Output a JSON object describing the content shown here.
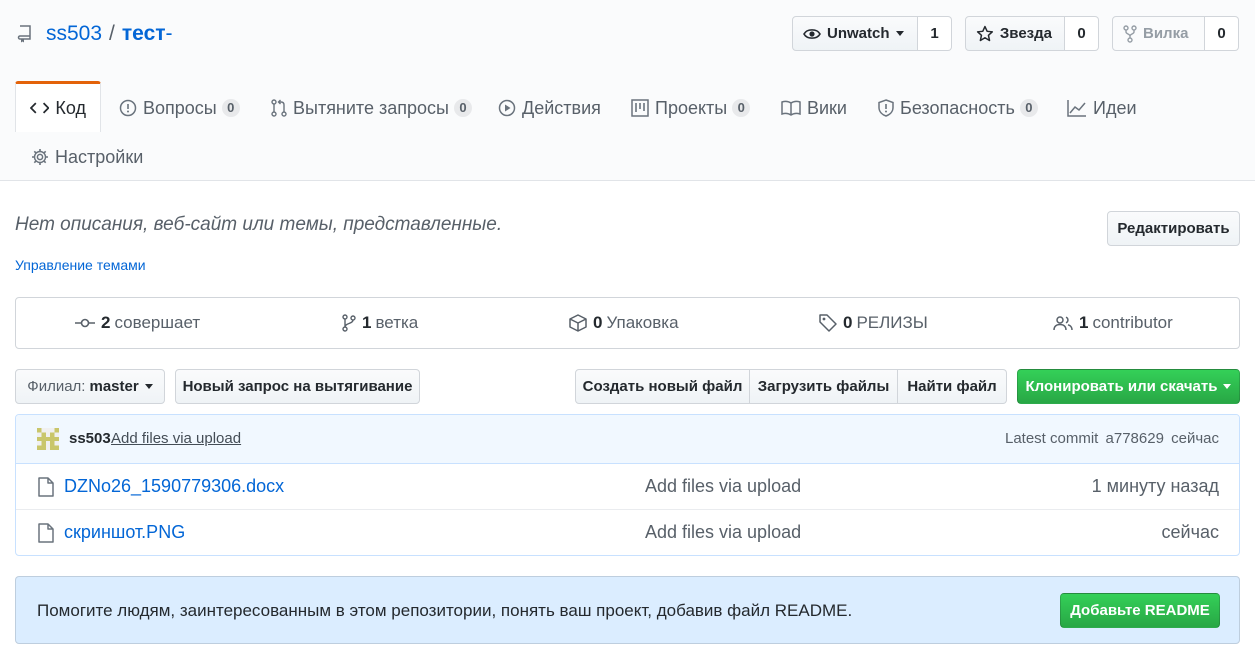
{
  "repo": {
    "owner": "ss503",
    "separator": "/",
    "name": "тест",
    "suffix": "-"
  },
  "social": {
    "watch": {
      "label": "Unwatch",
      "count": "1"
    },
    "star": {
      "label": "Звезда",
      "count": "0"
    },
    "fork": {
      "label": "Вилка",
      "count": "0"
    }
  },
  "tabs": [
    {
      "label": "Код",
      "counter": null
    },
    {
      "label": "Вопросы",
      "counter": "0"
    },
    {
      "label": "Вытяните запросы",
      "counter": "0"
    },
    {
      "label": "Действия",
      "counter": null
    },
    {
      "label": "Проекты",
      "counter": "0"
    },
    {
      "label": "Вики",
      "counter": null
    },
    {
      "label": "Безопасность",
      "counter": "0"
    },
    {
      "label": "Идеи",
      "counter": null
    },
    {
      "label": "Настройки",
      "counter": null
    }
  ],
  "about": {
    "description": "Нет описания, веб-сайт или темы, представленные.",
    "edit_label": "Редактировать",
    "topics_link": "Управление темами"
  },
  "summary": {
    "commits": {
      "count": "2",
      "label": "совершает"
    },
    "branches": {
      "count": "1",
      "label": "ветка"
    },
    "packages": {
      "count": "0",
      "label": "Упаковка"
    },
    "releases": {
      "count": "0",
      "label": "РЕЛИЗЫ"
    },
    "contributors": {
      "count": "1",
      "label": "contributor"
    }
  },
  "file_nav": {
    "branch_prefix": "Филиал:",
    "branch_name": "master",
    "new_pr": "Новый запрос на вытягивание",
    "create_file": "Создать новый файл",
    "upload_files": "Загрузить файлы",
    "find_file": "Найти файл",
    "clone": "Клонировать или скачать"
  },
  "commit": {
    "author": "ss503",
    "message": "Add files via upload",
    "latest_label": "Latest commit",
    "sha": "a778629",
    "time": "сейчас"
  },
  "files": [
    {
      "name": "DZNo26_1590779306.docx",
      "message": "Add files via upload",
      "age": "1 минуту назад"
    },
    {
      "name": "скриншот.PNG",
      "message": "Add files via upload",
      "age": "сейчас"
    }
  ],
  "readme": {
    "text": "Помогите людям, заинтересованным в этом репозитории, понять ваш проект, добавив файл README.",
    "button": "Добавьте README"
  },
  "colors": {
    "link": "#0366d6",
    "tab_accent": "#e36209",
    "green": "#28a745",
    "readme_bg": "#dbedff"
  }
}
